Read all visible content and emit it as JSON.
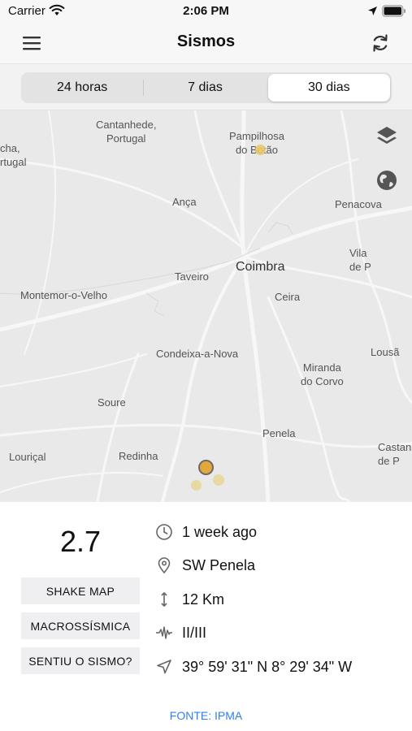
{
  "status_bar": {
    "carrier": "Carrier",
    "time": "2:06 PM"
  },
  "nav": {
    "title": "Sismos",
    "menu_icon": "hamburger-menu-icon",
    "refresh_icon": "refresh-icon"
  },
  "filters": {
    "tabs": [
      "24 horas",
      "7 dias",
      "30 dias"
    ],
    "selected": "30 dias"
  },
  "map": {
    "places": [
      "Cantanhede,",
      "Portugal",
      "Pampilhosa",
      "do Botão",
      "cha,",
      "rtugal",
      "Ança",
      "Penacova",
      "Coimbra",
      "Taveiro",
      "Montemor-o-Velho",
      "Ceira",
      "Vila",
      "de P",
      "Condeixa-a-Nova",
      "Lousã",
      "Miranda",
      "do Corvo",
      "Soure",
      "Penela",
      "Castan",
      "de P",
      "Louriçal",
      "Redinha"
    ],
    "controls": [
      "layers-icon",
      "globe-icon"
    ],
    "marker_colors": {
      "selected_fill": "#e3a83c",
      "selected_border": "#6b6b6b",
      "marker": "#e8c96a"
    }
  },
  "event": {
    "magnitude": "2.7",
    "buttons": [
      "SHAKE MAP",
      "MACROSSÍSMICA",
      "SENTIU O SISMO?"
    ],
    "time_ago": "1 week ago",
    "location": "SW Penela",
    "depth": "12 Km",
    "intensity": "II/III",
    "coordinates": "39° 59' 31\" N  8° 29' 34\" W"
  },
  "footer": {
    "source": "FONTE: IPMA",
    "link_color": "#2f80ed"
  }
}
